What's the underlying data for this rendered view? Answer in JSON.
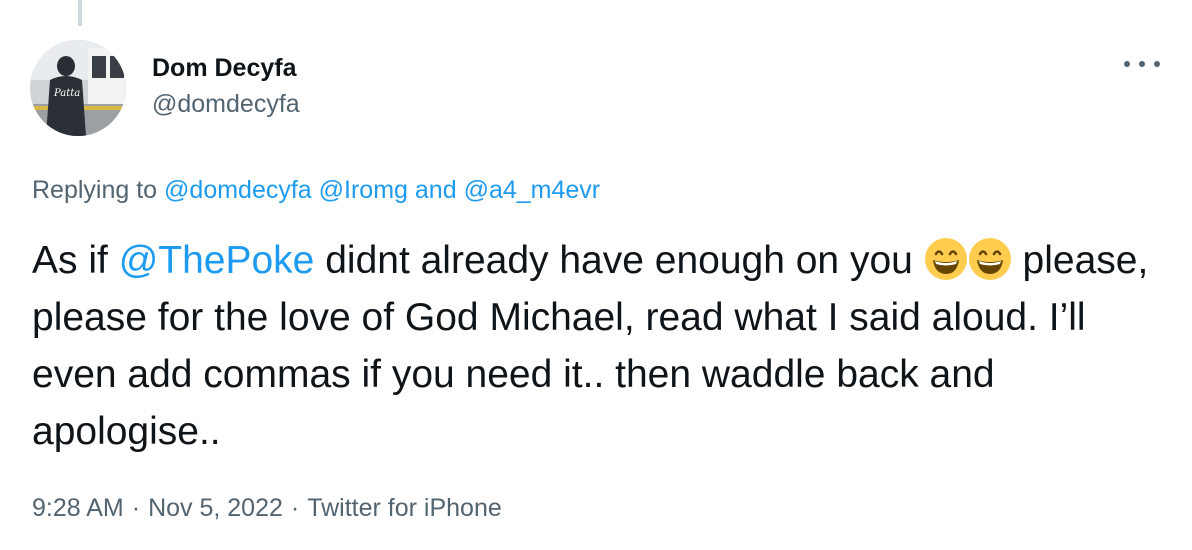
{
  "author": {
    "display_name": "Dom Decyfa",
    "handle": "@domdecyfa",
    "avatar_icon": "user-avatar-photo"
  },
  "more_options_icon": "ellipsis-icon",
  "reply_context": {
    "prefix": "Replying to",
    "mention_1": "@domdecyfa",
    "mention_2": "@Iromg",
    "conjunction": "and",
    "mention_3": "@a4_m4evr"
  },
  "tweet": {
    "text_before_mention": "As if ",
    "mention": "@ThePoke",
    "text_after_mention": " didnt already have enough on you ",
    "emoji_name": "grinning-face-with-smiling-eyes",
    "text_rest": " please, please for the love of God Michael, read what I said aloud. I’ll even add commas if you need it.. then waddle back and apologise.."
  },
  "meta": {
    "time": "9:28 AM",
    "separator": "·",
    "date": "Nov 5, 2022",
    "source": "Twitter for iPhone"
  },
  "colors": {
    "link": "#1d9bf0",
    "secondary_text": "#536471",
    "primary_text": "#0f1419",
    "thread_line": "#cfd9de"
  }
}
